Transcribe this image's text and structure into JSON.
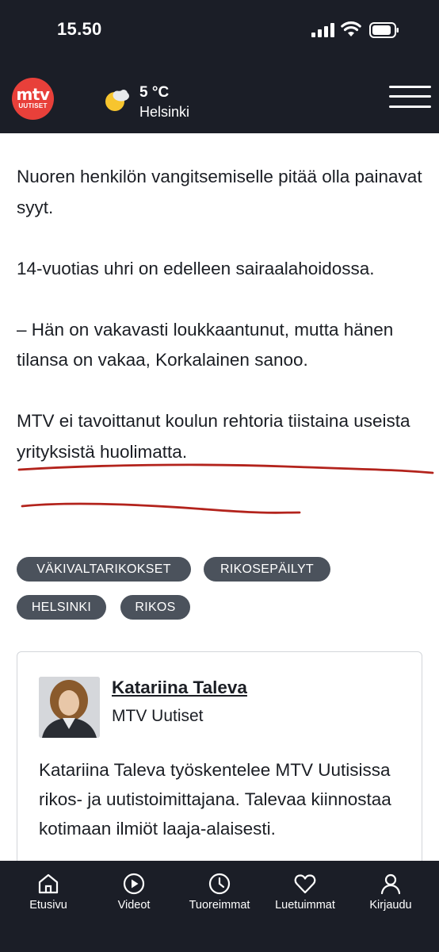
{
  "status_bar": {
    "time": "15.50"
  },
  "header": {
    "logo_main": "mtv",
    "logo_sub": "UUTISET",
    "weather_icon": "partly-sunny-icon",
    "temperature": "5 °C",
    "city": "Helsinki",
    "menu_icon": "hamburger-menu-icon"
  },
  "article": {
    "paragraphs": [
      "Nuoren henkilön vangitsemiselle pitää olla painavat syyt.",
      "14-vuotias uhri on edelleen sairaalahoidossa.",
      "– Hän on vakavasti loukkaantunut, mutta hänen tilansa on vakaa, Korkalainen sanoo.",
      "MTV ei tavoittanut koulun rehtoria tiistaina useista yrityksistä huolimatta."
    ],
    "annotation_color": "#b3231c"
  },
  "tags": [
    "VÄKIVALTARIKOKSET",
    "RIKOSEPÄILYT",
    "HELSINKI",
    "RIKOS"
  ],
  "author": {
    "name": "Katariina Taleva",
    "organization": "MTV Uutiset",
    "bio": "Katariina Taleva työskentelee MTV Uutisissa rikos- ja uutistoimittajana. Talevaa kiinnostaa kotimaan ilmiöt laaja-alaisesti."
  },
  "bottom_nav": [
    {
      "label": "Etusivu",
      "icon": "home-icon"
    },
    {
      "label": "Videot",
      "icon": "play-icon"
    },
    {
      "label": "Tuoreimmat",
      "icon": "clock-icon"
    },
    {
      "label": "Luetuimmat",
      "icon": "heart-icon"
    },
    {
      "label": "Kirjaudu",
      "icon": "user-icon"
    }
  ],
  "colors": {
    "header_bg": "#1b1e27",
    "brand_red": "#e8403a",
    "tag_bg": "#4b525c"
  }
}
